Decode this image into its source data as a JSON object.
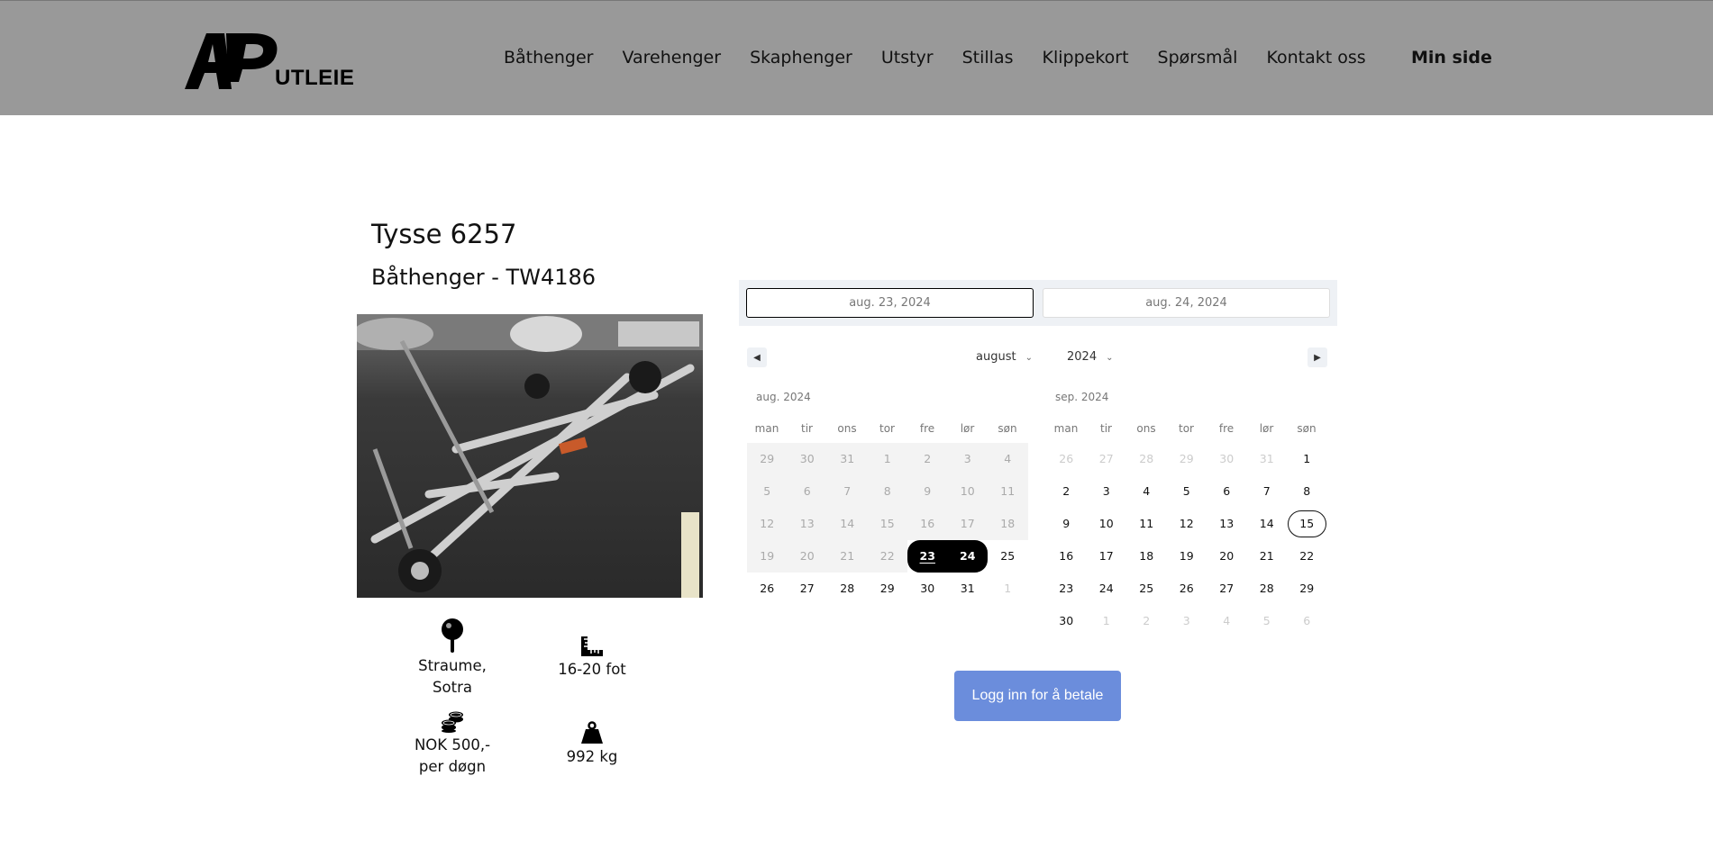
{
  "brand": {
    "logo_text": "UTLEIE"
  },
  "nav": {
    "items": [
      "Båthenger",
      "Varehenger",
      "Skaphenger",
      "Utstyr",
      "Stillas",
      "Klippekort",
      "Spørsmål",
      "Kontakt oss"
    ],
    "min_side": "Min side"
  },
  "product": {
    "title": "Tysse 6257",
    "subtitle": "Båthenger - TW4186",
    "location_line1": "Straume,",
    "location_line2": "Sotra",
    "length": "16-20 fot",
    "price_line1": "NOK 500,-",
    "price_line2": "per døgn",
    "weight": "992 kg"
  },
  "booking": {
    "start_date": "aug. 23, 2024",
    "end_date": "aug. 24, 2024",
    "month_select": "august",
    "year_select": "2024",
    "left_month_label": "aug. 2024",
    "right_month_label": "sep. 2024",
    "weekdays": [
      "man",
      "tir",
      "ons",
      "tor",
      "fre",
      "lør",
      "søn"
    ],
    "august_weeks": [
      [
        "29",
        "30",
        "31",
        "1",
        "2",
        "3",
        "4"
      ],
      [
        "5",
        "6",
        "7",
        "8",
        "9",
        "10",
        "11"
      ],
      [
        "12",
        "13",
        "14",
        "15",
        "16",
        "17",
        "18"
      ],
      [
        "19",
        "20",
        "21",
        "22",
        "23",
        "24",
        "25"
      ],
      [
        "26",
        "27",
        "28",
        "29",
        "30",
        "31",
        "1"
      ]
    ],
    "september_weeks": [
      [
        "26",
        "27",
        "28",
        "29",
        "30",
        "31",
        "1"
      ],
      [
        "2",
        "3",
        "4",
        "5",
        "6",
        "7",
        "8"
      ],
      [
        "9",
        "10",
        "11",
        "12",
        "13",
        "14",
        "15"
      ],
      [
        "16",
        "17",
        "18",
        "19",
        "20",
        "21",
        "22"
      ],
      [
        "23",
        "24",
        "25",
        "26",
        "27",
        "28",
        "29"
      ],
      [
        "30",
        "1",
        "2",
        "3",
        "4",
        "5",
        "6"
      ]
    ],
    "pay_button": "Logg inn for å betale"
  },
  "icons": {
    "location": "map-pin-icon",
    "length": "ruler-icon",
    "price": "coins-icon",
    "weight": "weight-icon",
    "prev": "triangle-left-icon",
    "next": "triangle-right-icon"
  },
  "colors": {
    "header_bg": "#999999",
    "pay_button": "#6b8ddc",
    "selected_day": "#000000"
  }
}
